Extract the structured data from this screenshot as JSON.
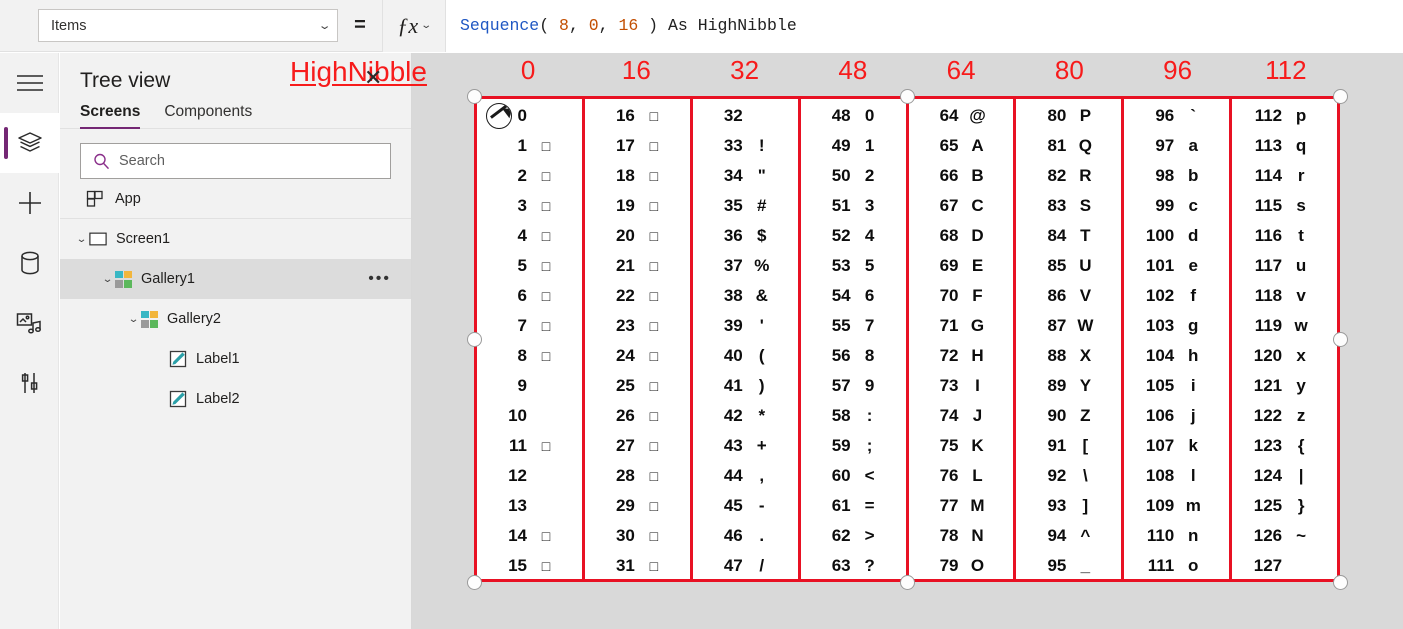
{
  "formula_bar": {
    "property": "Items",
    "property_chevron": "⌄",
    "equals": "=",
    "fx_label": "ƒx",
    "fx_chevron": "⌄",
    "formula_text": "Sequence( 8, 0, 16 ) As HighNibble",
    "tokens": [
      {
        "text": "Sequence",
        "kind": "fn"
      },
      {
        "text": "( ",
        "kind": "pun"
      },
      {
        "text": "8",
        "kind": "num"
      },
      {
        "text": ", ",
        "kind": "pun"
      },
      {
        "text": "0",
        "kind": "num"
      },
      {
        "text": ", ",
        "kind": "pun"
      },
      {
        "text": "16",
        "kind": "num"
      },
      {
        "text": " ) ",
        "kind": "pun"
      },
      {
        "text": "As HighNibble",
        "kind": "kw"
      }
    ]
  },
  "icon_rail": {
    "items": [
      {
        "name": "hamburger-menu-icon",
        "active": false
      },
      {
        "name": "tree-view-layers-icon",
        "active": true
      },
      {
        "name": "insert-plus-icon",
        "active": false
      },
      {
        "name": "data-cylinder-icon",
        "active": false
      },
      {
        "name": "media-icon",
        "active": false
      },
      {
        "name": "settings-tools-icon",
        "active": false
      }
    ]
  },
  "tree_panel": {
    "title": "Tree view",
    "tabs": [
      {
        "label": "Screens",
        "active": true
      },
      {
        "label": "Components",
        "active": false
      }
    ],
    "search": {
      "placeholder": "Search",
      "value": ""
    },
    "app_row": {
      "label": "App"
    },
    "nodes": [
      {
        "label": "Screen1",
        "indent": 1,
        "chevron": "⌄",
        "icon": "screen-icon",
        "selected": false,
        "ellipsis": false
      },
      {
        "label": "Gallery1",
        "indent": 2,
        "chevron": "⌄",
        "icon": "gallery-icon",
        "selected": true,
        "ellipsis": true
      },
      {
        "label": "Gallery2",
        "indent": 3,
        "chevron": "⌄",
        "icon": "gallery-icon",
        "selected": false,
        "ellipsis": false
      },
      {
        "label": "Label1",
        "indent": 4,
        "chevron": "",
        "icon": "label-icon",
        "selected": false,
        "ellipsis": false
      },
      {
        "label": "Label2",
        "indent": 4,
        "chevron": "",
        "icon": "label-icon",
        "selected": false,
        "ellipsis": false
      }
    ]
  },
  "canvas": {
    "annotation": {
      "text": "HighNibble",
      "xmark": "✕",
      "color": "#f71b1b"
    },
    "column_headers": [
      "0",
      "16",
      "32",
      "48",
      "64",
      "80",
      "96",
      "112"
    ],
    "header_color": "#f71b1b",
    "gallery_border_color": "#e81123",
    "columns": [
      {
        "header": "0",
        "rows": [
          {
            "num": "0",
            "glyph": "",
            "box": false
          },
          {
            "num": "1",
            "glyph": "□",
            "box": true
          },
          {
            "num": "2",
            "glyph": "□",
            "box": true
          },
          {
            "num": "3",
            "glyph": "□",
            "box": true
          },
          {
            "num": "4",
            "glyph": "□",
            "box": true
          },
          {
            "num": "5",
            "glyph": "□",
            "box": true
          },
          {
            "num": "6",
            "glyph": "□",
            "box": true
          },
          {
            "num": "7",
            "glyph": "□",
            "box": true
          },
          {
            "num": "8",
            "glyph": "□",
            "box": true
          },
          {
            "num": "9",
            "glyph": "",
            "box": false
          },
          {
            "num": "10",
            "glyph": "",
            "box": false
          },
          {
            "num": "11",
            "glyph": "□",
            "box": true
          },
          {
            "num": "12",
            "glyph": "",
            "box": false
          },
          {
            "num": "13",
            "glyph": "",
            "box": false
          },
          {
            "num": "14",
            "glyph": "□",
            "box": true
          },
          {
            "num": "15",
            "glyph": "□",
            "box": true
          }
        ]
      },
      {
        "header": "16",
        "rows": [
          {
            "num": "16",
            "glyph": "□",
            "box": true
          },
          {
            "num": "17",
            "glyph": "□",
            "box": true
          },
          {
            "num": "18",
            "glyph": "□",
            "box": true
          },
          {
            "num": "19",
            "glyph": "□",
            "box": true
          },
          {
            "num": "20",
            "glyph": "□",
            "box": true
          },
          {
            "num": "21",
            "glyph": "□",
            "box": true
          },
          {
            "num": "22",
            "glyph": "□",
            "box": true
          },
          {
            "num": "23",
            "glyph": "□",
            "box": true
          },
          {
            "num": "24",
            "glyph": "□",
            "box": true
          },
          {
            "num": "25",
            "glyph": "□",
            "box": true
          },
          {
            "num": "26",
            "glyph": "□",
            "box": true
          },
          {
            "num": "27",
            "glyph": "□",
            "box": true
          },
          {
            "num": "28",
            "glyph": "□",
            "box": true
          },
          {
            "num": "29",
            "glyph": "□",
            "box": true
          },
          {
            "num": "30",
            "glyph": "□",
            "box": true
          },
          {
            "num": "31",
            "glyph": "□",
            "box": true
          }
        ]
      },
      {
        "header": "32",
        "rows": [
          {
            "num": "32",
            "glyph": "",
            "box": false
          },
          {
            "num": "33",
            "glyph": "!",
            "box": false
          },
          {
            "num": "34",
            "glyph": "\"",
            "box": false
          },
          {
            "num": "35",
            "glyph": "#",
            "box": false
          },
          {
            "num": "36",
            "glyph": "$",
            "box": false
          },
          {
            "num": "37",
            "glyph": "%",
            "box": false
          },
          {
            "num": "38",
            "glyph": "&",
            "box": false
          },
          {
            "num": "39",
            "glyph": "'",
            "box": false
          },
          {
            "num": "40",
            "glyph": "(",
            "box": false
          },
          {
            "num": "41",
            "glyph": ")",
            "box": false
          },
          {
            "num": "42",
            "glyph": "*",
            "box": false
          },
          {
            "num": "43",
            "glyph": "+",
            "box": false
          },
          {
            "num": "44",
            "glyph": ",",
            "box": false
          },
          {
            "num": "45",
            "glyph": "-",
            "box": false
          },
          {
            "num": "46",
            "glyph": ".",
            "box": false
          },
          {
            "num": "47",
            "glyph": "/",
            "box": false
          }
        ]
      },
      {
        "header": "48",
        "rows": [
          {
            "num": "48",
            "glyph": "0",
            "box": false
          },
          {
            "num": "49",
            "glyph": "1",
            "box": false
          },
          {
            "num": "50",
            "glyph": "2",
            "box": false
          },
          {
            "num": "51",
            "glyph": "3",
            "box": false
          },
          {
            "num": "52",
            "glyph": "4",
            "box": false
          },
          {
            "num": "53",
            "glyph": "5",
            "box": false
          },
          {
            "num": "54",
            "glyph": "6",
            "box": false
          },
          {
            "num": "55",
            "glyph": "7",
            "box": false
          },
          {
            "num": "56",
            "glyph": "8",
            "box": false
          },
          {
            "num": "57",
            "glyph": "9",
            "box": false
          },
          {
            "num": "58",
            "glyph": ":",
            "box": false
          },
          {
            "num": "59",
            "glyph": ";",
            "box": false
          },
          {
            "num": "60",
            "glyph": "<",
            "box": false
          },
          {
            "num": "61",
            "glyph": "=",
            "box": false
          },
          {
            "num": "62",
            "glyph": ">",
            "box": false
          },
          {
            "num": "63",
            "glyph": "?",
            "box": false
          }
        ]
      },
      {
        "header": "64",
        "rows": [
          {
            "num": "64",
            "glyph": "@",
            "box": false
          },
          {
            "num": "65",
            "glyph": "A",
            "box": false
          },
          {
            "num": "66",
            "glyph": "B",
            "box": false
          },
          {
            "num": "67",
            "glyph": "C",
            "box": false
          },
          {
            "num": "68",
            "glyph": "D",
            "box": false
          },
          {
            "num": "69",
            "glyph": "E",
            "box": false
          },
          {
            "num": "70",
            "glyph": "F",
            "box": false
          },
          {
            "num": "71",
            "glyph": "G",
            "box": false
          },
          {
            "num": "72",
            "glyph": "H",
            "box": false
          },
          {
            "num": "73",
            "glyph": "I",
            "box": false
          },
          {
            "num": "74",
            "glyph": "J",
            "box": false
          },
          {
            "num": "75",
            "glyph": "K",
            "box": false
          },
          {
            "num": "76",
            "glyph": "L",
            "box": false
          },
          {
            "num": "77",
            "glyph": "M",
            "box": false
          },
          {
            "num": "78",
            "glyph": "N",
            "box": false
          },
          {
            "num": "79",
            "glyph": "O",
            "box": false
          }
        ]
      },
      {
        "header": "80",
        "rows": [
          {
            "num": "80",
            "glyph": "P",
            "box": false
          },
          {
            "num": "81",
            "glyph": "Q",
            "box": false
          },
          {
            "num": "82",
            "glyph": "R",
            "box": false
          },
          {
            "num": "83",
            "glyph": "S",
            "box": false
          },
          {
            "num": "84",
            "glyph": "T",
            "box": false
          },
          {
            "num": "85",
            "glyph": "U",
            "box": false
          },
          {
            "num": "86",
            "glyph": "V",
            "box": false
          },
          {
            "num": "87",
            "glyph": "W",
            "box": false
          },
          {
            "num": "88",
            "glyph": "X",
            "box": false
          },
          {
            "num": "89",
            "glyph": "Y",
            "box": false
          },
          {
            "num": "90",
            "glyph": "Z",
            "box": false
          },
          {
            "num": "91",
            "glyph": "[",
            "box": false
          },
          {
            "num": "92",
            "glyph": "\\",
            "box": false
          },
          {
            "num": "93",
            "glyph": "]",
            "box": false
          },
          {
            "num": "94",
            "glyph": "^",
            "box": false
          },
          {
            "num": "95",
            "glyph": "_",
            "box": false
          }
        ]
      },
      {
        "header": "96",
        "rows": [
          {
            "num": "96",
            "glyph": "`",
            "box": false
          },
          {
            "num": "97",
            "glyph": "a",
            "box": false
          },
          {
            "num": "98",
            "glyph": "b",
            "box": false
          },
          {
            "num": "99",
            "glyph": "c",
            "box": false
          },
          {
            "num": "100",
            "glyph": "d",
            "box": false
          },
          {
            "num": "101",
            "glyph": "e",
            "box": false
          },
          {
            "num": "102",
            "glyph": "f",
            "box": false
          },
          {
            "num": "103",
            "glyph": "g",
            "box": false
          },
          {
            "num": "104",
            "glyph": "h",
            "box": false
          },
          {
            "num": "105",
            "glyph": "i",
            "box": false
          },
          {
            "num": "106",
            "glyph": "j",
            "box": false
          },
          {
            "num": "107",
            "glyph": "k",
            "box": false
          },
          {
            "num": "108",
            "glyph": "l",
            "box": false
          },
          {
            "num": "109",
            "glyph": "m",
            "box": false
          },
          {
            "num": "110",
            "glyph": "n",
            "box": false
          },
          {
            "num": "111",
            "glyph": "o",
            "box": false
          }
        ]
      },
      {
        "header": "112",
        "rows": [
          {
            "num": "112",
            "glyph": "p",
            "box": false
          },
          {
            "num": "113",
            "glyph": "q",
            "box": false
          },
          {
            "num": "114",
            "glyph": "r",
            "box": false
          },
          {
            "num": "115",
            "glyph": "s",
            "box": false
          },
          {
            "num": "116",
            "glyph": "t",
            "box": false
          },
          {
            "num": "117",
            "glyph": "u",
            "box": false
          },
          {
            "num": "118",
            "glyph": "v",
            "box": false
          },
          {
            "num": "119",
            "glyph": "w",
            "box": false
          },
          {
            "num": "120",
            "glyph": "x",
            "box": false
          },
          {
            "num": "121",
            "glyph": "y",
            "box": false
          },
          {
            "num": "122",
            "glyph": "z",
            "box": false
          },
          {
            "num": "123",
            "glyph": "{",
            "box": false
          },
          {
            "num": "124",
            "glyph": "|",
            "box": false
          },
          {
            "num": "125",
            "glyph": "}",
            "box": false
          },
          {
            "num": "126",
            "glyph": "~",
            "box": false
          },
          {
            "num": "127",
            "glyph": "",
            "box": false
          }
        ]
      }
    ]
  }
}
